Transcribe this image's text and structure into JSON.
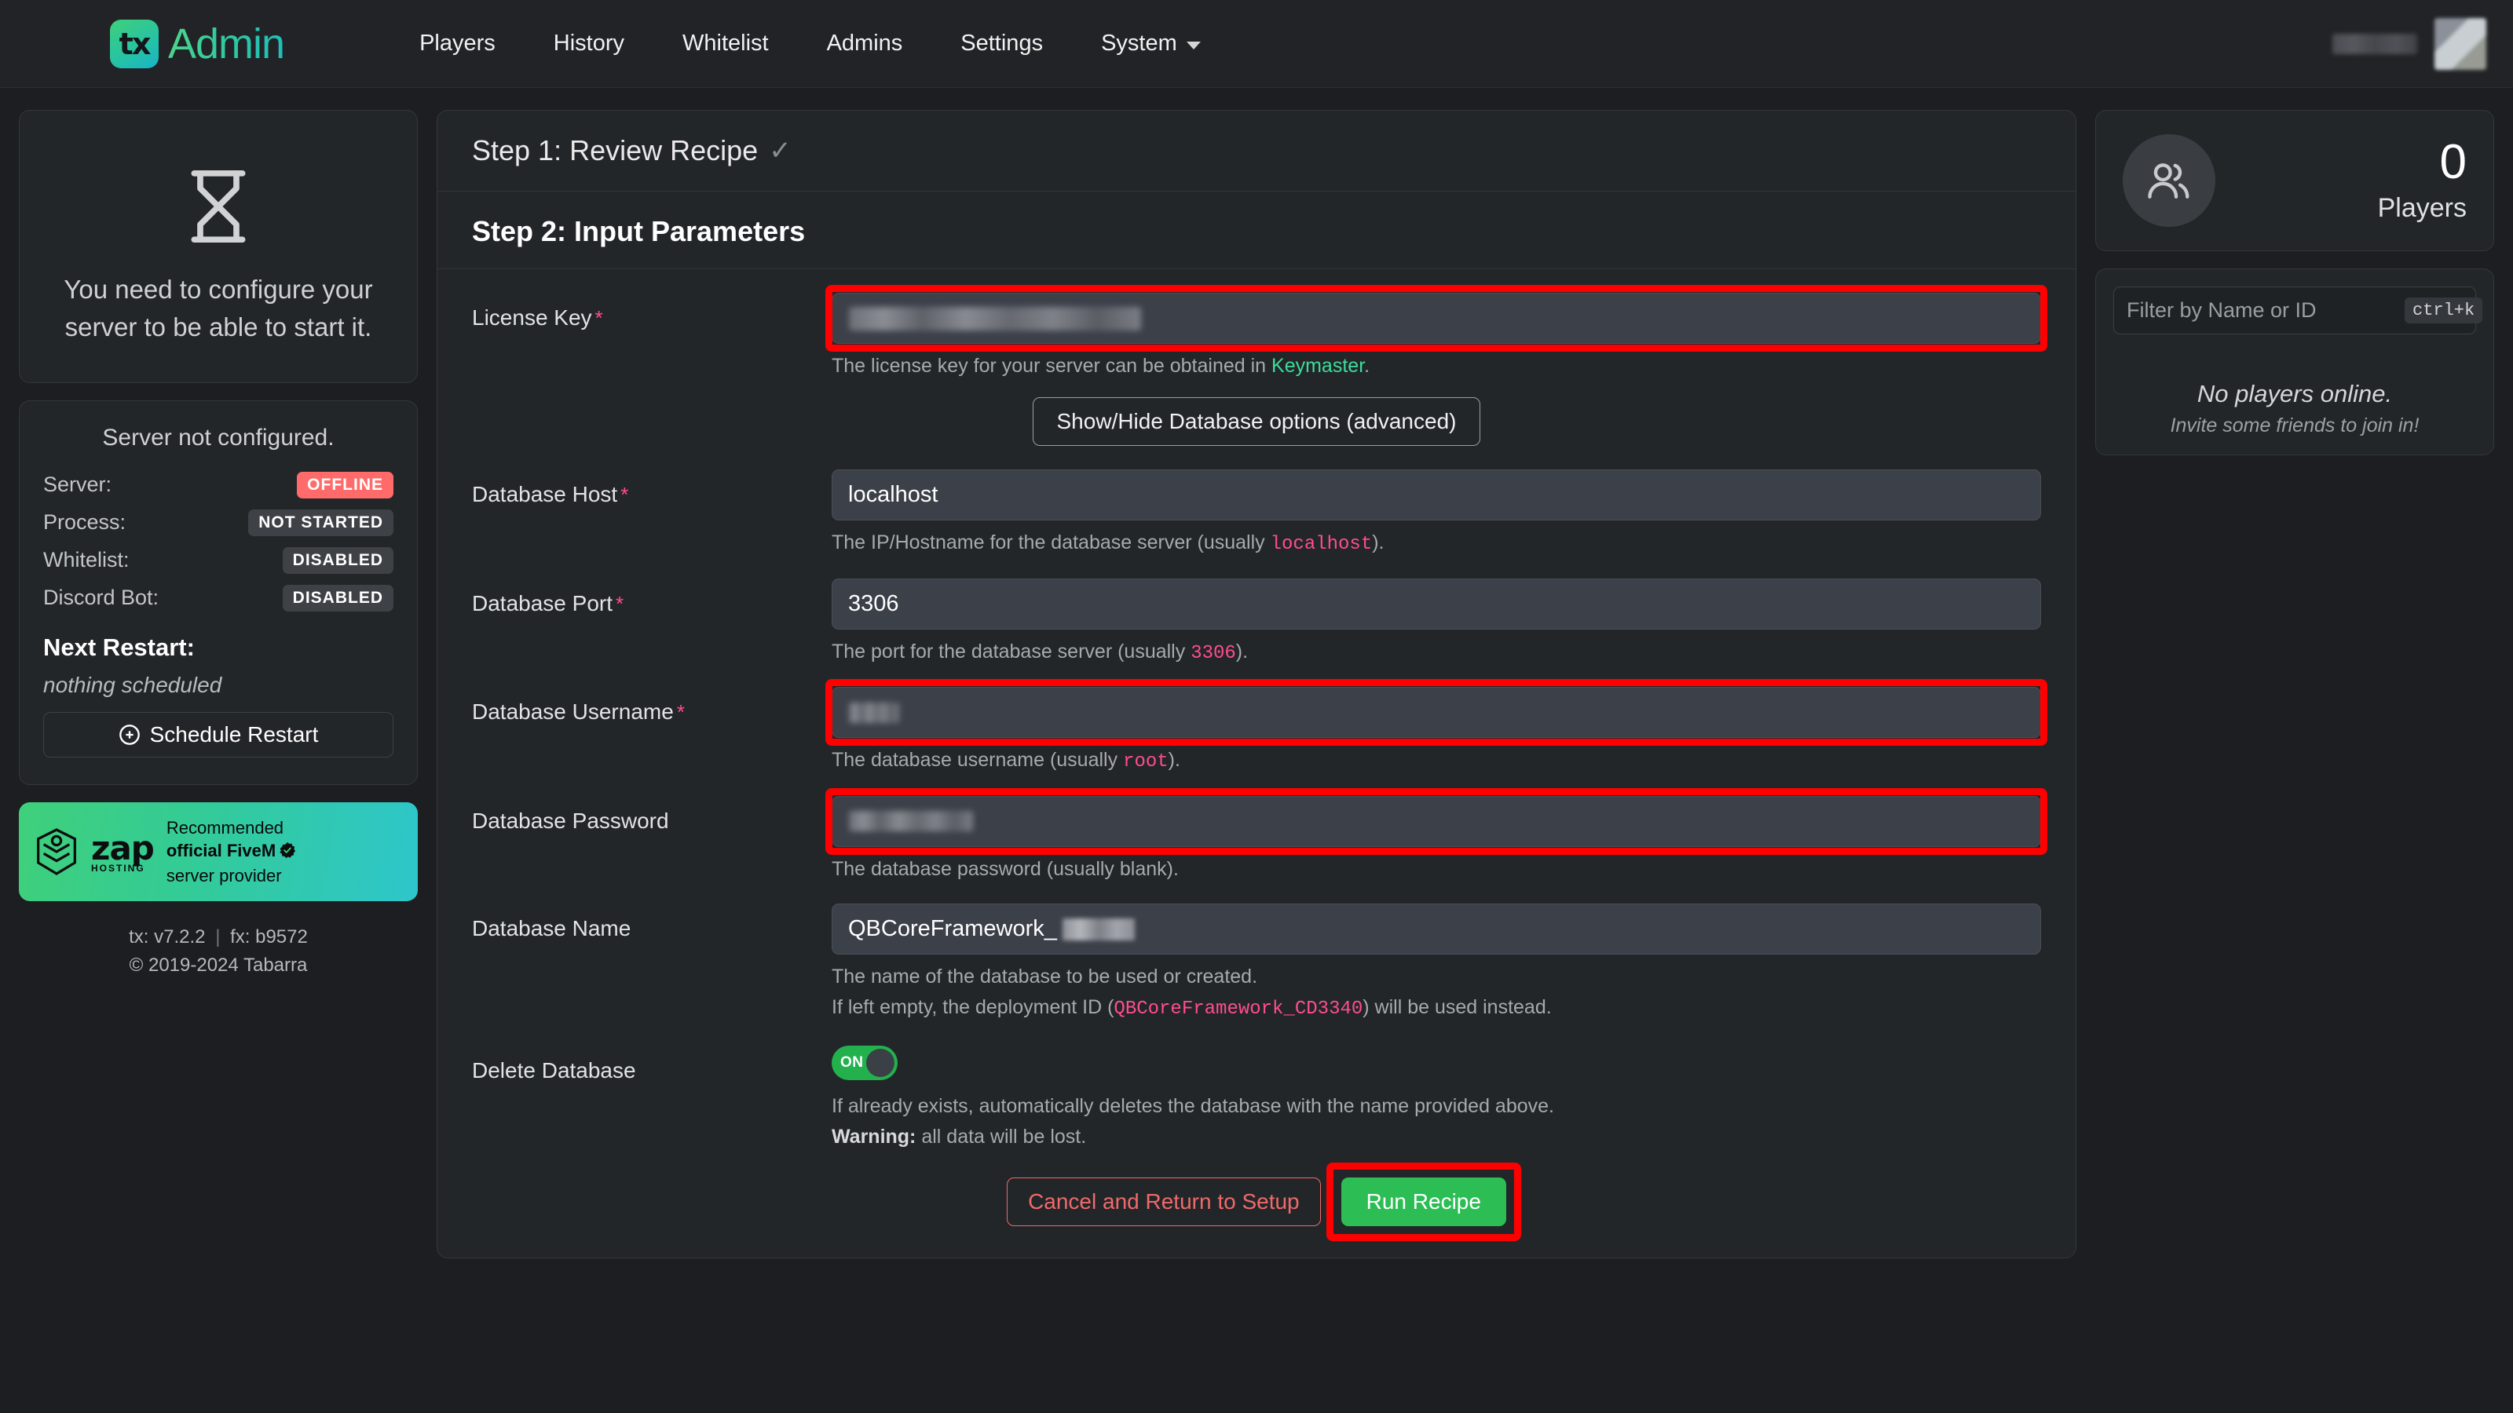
{
  "brand": {
    "mark": "tx",
    "name": "Admin"
  },
  "nav": {
    "items": [
      {
        "label": "Players"
      },
      {
        "label": "History"
      },
      {
        "label": "Whitelist"
      },
      {
        "label": "Admins"
      },
      {
        "label": "Settings"
      },
      {
        "label": "System"
      }
    ]
  },
  "sidebar": {
    "offline_icon": "hourglass-icon",
    "offline_message": "You need to configure your server to be able to start it.",
    "status": {
      "title": "Server not configured.",
      "rows": [
        {
          "label": "Server:",
          "value": "OFFLINE",
          "variant": "offline"
        },
        {
          "label": "Process:",
          "value": "NOT STARTED",
          "variant": "neutral"
        },
        {
          "label": "Whitelist:",
          "value": "DISABLED",
          "variant": "neutral"
        },
        {
          "label": "Discord Bot:",
          "value": "DISABLED",
          "variant": "neutral"
        }
      ],
      "next_restart_label": "Next Restart:",
      "next_restart_value": "nothing scheduled",
      "schedule_button": "Schedule Restart"
    },
    "zap": {
      "logo_word": "zap",
      "logo_sub": "HOSTING",
      "line1": "Recommended",
      "line2": "official FiveM",
      "line3": "server provider"
    },
    "footer": {
      "tx_version": "tx: v7.2.2",
      "separator": "|",
      "fx_version": "fx: b9572",
      "copyright": "© 2019-2024 Tabarra"
    }
  },
  "main": {
    "step1_title": "Step 1: Review Recipe",
    "step1_check": "✓",
    "step2_title": "Step 2: Input Parameters",
    "fields": {
      "license_key": {
        "label": "License Key",
        "required": "*",
        "value": "",
        "redacted": true,
        "hint_before": "The license key for your server can be obtained in ",
        "hint_link": "Keymaster",
        "hint_after": "."
      },
      "show_hide_db": {
        "label": "Show/Hide Database options (advanced)"
      },
      "db_host": {
        "label": "Database Host",
        "required": "*",
        "value": "localhost",
        "hint_before": "The IP/Hostname for the database server (usually ",
        "hint_code": "localhost",
        "hint_after": ")."
      },
      "db_port": {
        "label": "Database Port",
        "required": "*",
        "value": "3306",
        "hint_before": "The port for the database server (usually ",
        "hint_code": "3306",
        "hint_after": ")."
      },
      "db_username": {
        "label": "Database Username",
        "required": "*",
        "value": "",
        "redacted": true,
        "hint_before": "The database username (usually ",
        "hint_code": "root",
        "hint_after": ")."
      },
      "db_password": {
        "label": "Database Password",
        "required": "",
        "value": "",
        "redacted": true,
        "hint_before": "The database password (usually blank).",
        "hint_code": "",
        "hint_after": ""
      },
      "db_name": {
        "label": "Database Name",
        "required": "",
        "value": "QBCoreFramework_",
        "redacted_suffix": true,
        "hint_line1": "The name of the database to be used or created.",
        "hint2_before": "If left empty, the deployment ID (",
        "hint2_code": "QBCoreFramework_CD3340",
        "hint2_after": ") will be used instead."
      },
      "delete_database": {
        "label": "Delete Database",
        "toggle_state": "ON",
        "hint_line1": "If already exists, automatically deletes the database with the name provided above.",
        "hint_warning_label": "Warning:",
        "hint_warning_text": " all data will be lost."
      }
    },
    "actions": {
      "cancel_label": "Cancel and Return to Setup",
      "run_label": "Run Recipe"
    }
  },
  "right": {
    "players_card": {
      "count": "0",
      "label": "Players",
      "icon": "users-icon"
    },
    "filter": {
      "placeholder": "Filter by Name or ID",
      "value": "",
      "shortcut": "ctrl+k"
    },
    "empty": {
      "title": "No players online.",
      "subtitle": "Invite some friends to join in!"
    }
  },
  "colors": {
    "accent_green": "#2cbe55",
    "brand_gradient_start": "#3fd07a",
    "brand_gradient_end": "#18b4c6",
    "danger_red": "#ff6b6b",
    "annotation_red": "#ff0000",
    "code_pink": "#ff4d8d",
    "link_green": "#3ddc9a"
  }
}
